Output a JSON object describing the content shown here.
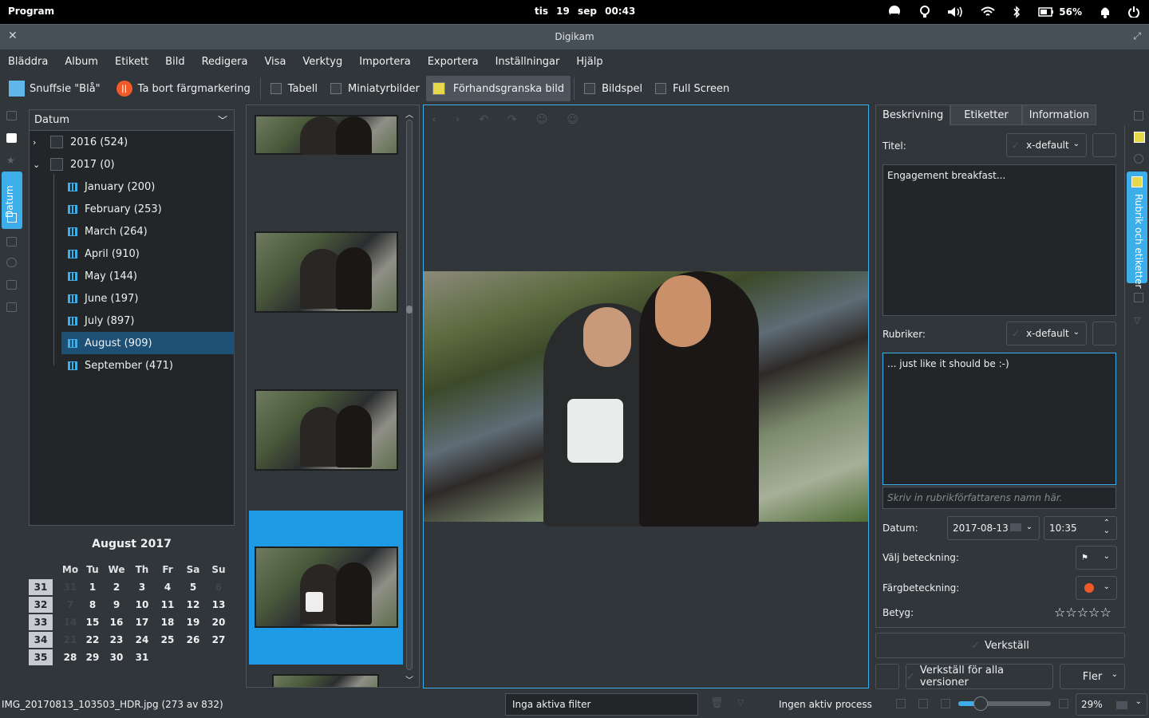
{
  "topbar": {
    "program": "Program",
    "datetime": "tis 19 sep   00:43",
    "battery": "56%",
    "icons": [
      "weather-icon",
      "bulb-icon",
      "volume-icon",
      "wifi-icon",
      "bluetooth-icon",
      "battery-icon",
      "bell-icon",
      "power-icon"
    ]
  },
  "window": {
    "title": "Digikam"
  },
  "menu": [
    "Bläddra",
    "Album",
    "Etikett",
    "Bild",
    "Redigera",
    "Visa",
    "Verktyg",
    "Importera",
    "Exportera",
    "Inställningar",
    "Hjälp"
  ],
  "toolbar": {
    "color_label": "Snuffsie \"Blå\"",
    "remove_color": "Ta bort färgmarkering",
    "table": "Tabell",
    "thumbnails": "Miniatyrbilder",
    "preview": "Förhandsgranska bild",
    "slideshow": "Bildspel",
    "fullscreen": "Full Screen"
  },
  "left_tab": "Datum",
  "tree": {
    "header": "Datum",
    "years": [
      "2016 (524)",
      "2017 (0)"
    ],
    "months": [
      "January (200)",
      "February (253)",
      "March (264)",
      "April (910)",
      "May (144)",
      "June (197)",
      "July (897)",
      "August (909)",
      "September (471)"
    ],
    "selected_index": 7
  },
  "calendar": {
    "caption": "August 2017",
    "weekdays": [
      "Mo",
      "Tu",
      "We",
      "Th",
      "Fr",
      "Sa",
      "Su"
    ],
    "weeks": [
      {
        "wk": "31",
        "days": [
          "31",
          "1",
          "2",
          "3",
          "4",
          "5",
          "6"
        ],
        "dim": [
          true,
          false,
          false,
          false,
          false,
          false,
          true
        ]
      },
      {
        "wk": "32",
        "days": [
          "7",
          "8",
          "9",
          "10",
          "11",
          "12",
          "13"
        ],
        "dim": [
          true,
          false,
          false,
          false,
          false,
          false,
          false
        ]
      },
      {
        "wk": "33",
        "days": [
          "14",
          "15",
          "16",
          "17",
          "18",
          "19",
          "20"
        ],
        "dim": [
          true,
          false,
          false,
          false,
          false,
          false,
          false
        ]
      },
      {
        "wk": "34",
        "days": [
          "21",
          "22",
          "23",
          "24",
          "25",
          "26",
          "27"
        ],
        "dim": [
          true,
          false,
          false,
          false,
          false,
          false,
          false
        ]
      },
      {
        "wk": "35",
        "days": [
          "28",
          "29",
          "30",
          "31",
          "",
          "",
          ""
        ],
        "dim": [
          false,
          false,
          false,
          false,
          false,
          false,
          false
        ]
      }
    ]
  },
  "right_panel": {
    "tabs": [
      "Beskrivning",
      "Etiketter",
      "Information"
    ],
    "title_label": "Titel:",
    "lang": "x-default",
    "title_text": "Engagement breakfast...",
    "caption_label": "Rubriker:",
    "caption_text": "... just like it should be :-)",
    "author_placeholder": "Skriv in rubrikförfattarens namn här.",
    "date_label": "Datum:",
    "date": "2017-08-13",
    "time": "10:35",
    "pick_label": "Välj beteckning:",
    "color_label": "Färgbeteckning:",
    "rating_label": "Betyg:",
    "rating": 0,
    "apply": "Verkställ",
    "apply_all": "Verkställ för alla versioner",
    "more": "Fler"
  },
  "right_tab": "Rubrik och etiketter",
  "status": {
    "filename": "IMG_20170813_103503_HDR.jpg (273 av 832)",
    "filters": "Inga aktiva filter",
    "process": "Ingen aktiv process",
    "zoom": "29%",
    "zoom_slider": 0.24
  },
  "colors": {
    "accent": "#3daee9",
    "selection": "#1e5075",
    "bg": "#31363b"
  }
}
